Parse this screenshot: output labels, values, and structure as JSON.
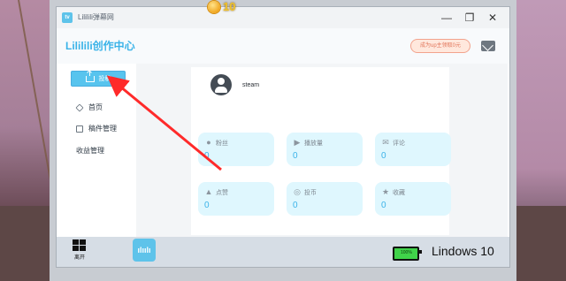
{
  "app": {
    "window_title": "Lililili弹幕网",
    "title": "Lililili创作中心",
    "upgrade_button": "成为up主领取0元",
    "coins": "10"
  },
  "sidebar": {
    "upload_button": "投稿",
    "items": [
      {
        "label": "首页"
      },
      {
        "label": "稿件管理"
      },
      {
        "label": "收益管理"
      }
    ]
  },
  "profile": {
    "username": "steam"
  },
  "stats": [
    {
      "label": "粉丝",
      "value": "0"
    },
    {
      "label": "播放量",
      "value": "0"
    },
    {
      "label": "评论",
      "value": "0"
    },
    {
      "label": "点赞",
      "value": "0"
    },
    {
      "label": "投币",
      "value": "0"
    },
    {
      "label": "收藏",
      "value": "0"
    }
  ],
  "taskbar": {
    "start_label": "离开",
    "battery_text": "100%",
    "os_name": "Lindows 10",
    "app_icon_text": "ılıılı"
  },
  "colors": {
    "accent": "#3bb3e8",
    "stat_bg": "#dff7fe",
    "arrow": "#ff2a2a",
    "battery": "#40d34a"
  },
  "icons": {
    "home": "home-icon",
    "manuscript": "doc-icon",
    "revenue": "coin-icon",
    "fans": "user-icon",
    "plays": "play-icon",
    "comments": "comment-icon",
    "likes": "thumb-up-icon",
    "coins": "coin-icon",
    "favorites": "star-icon"
  }
}
